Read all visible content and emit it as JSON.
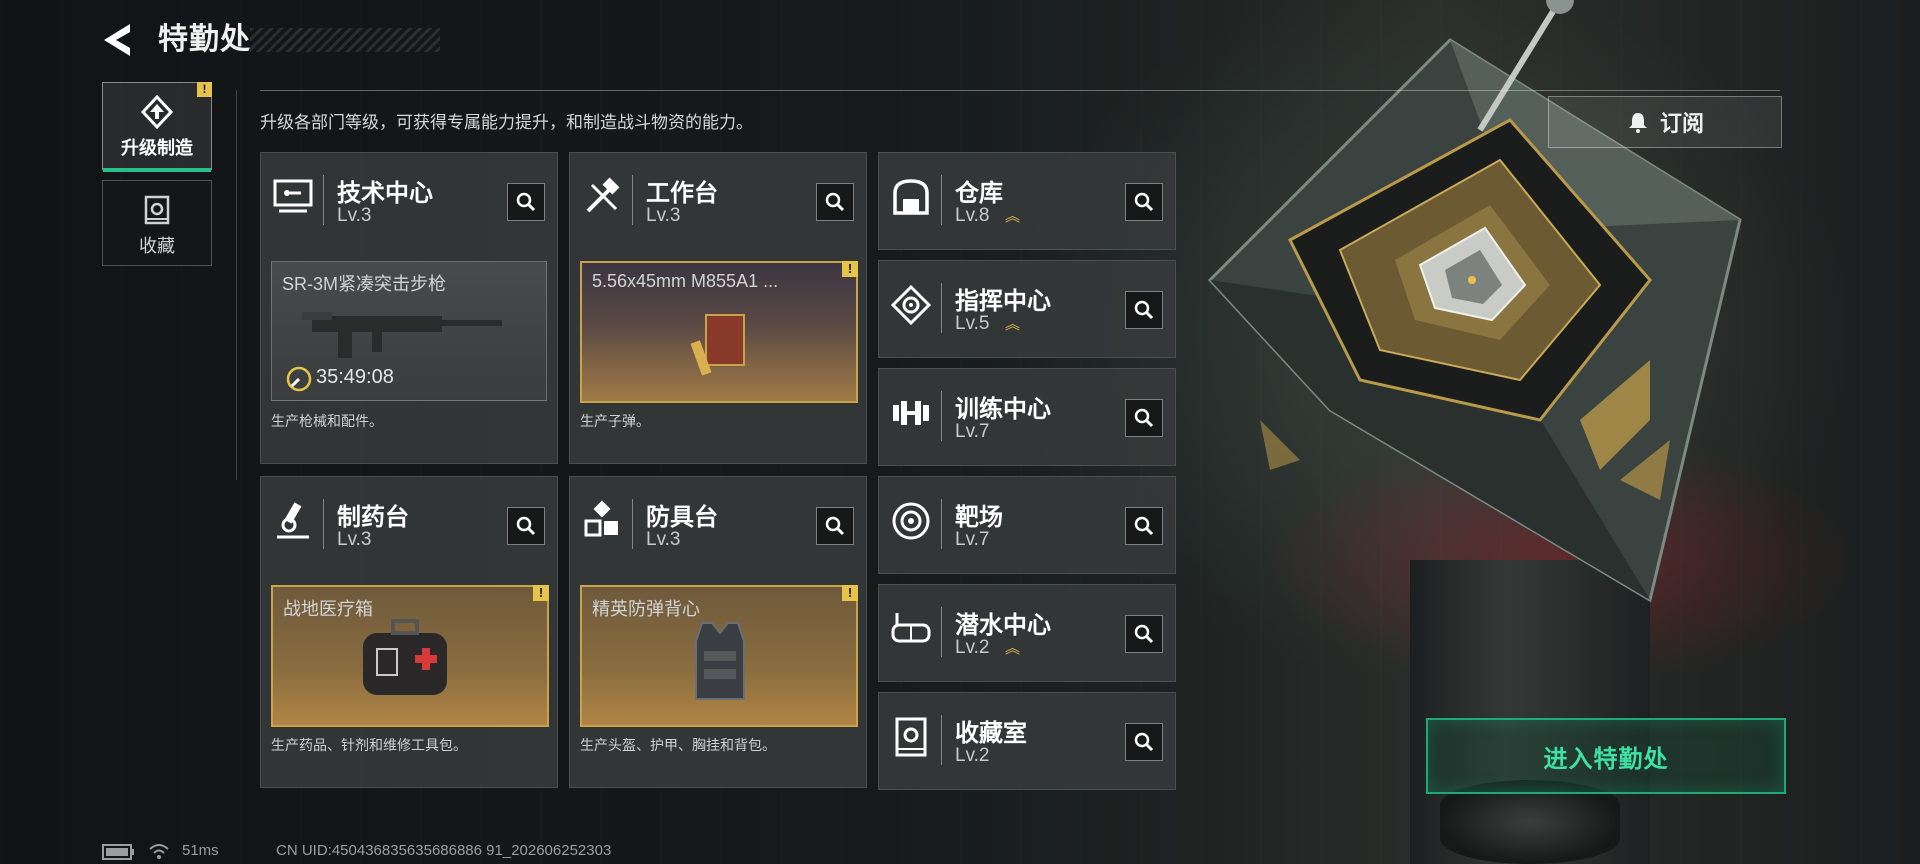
{
  "header": {
    "title": "特勤处"
  },
  "side_tabs": [
    {
      "label": "升级制造",
      "active": true,
      "badge": "!"
    },
    {
      "label": "收藏",
      "active": false
    }
  ],
  "description": "升级各部门等级，可获得专属能力提升，和制造战斗物资的能力。",
  "subscribe": {
    "label": "订阅"
  },
  "enter": {
    "label": "进入特勤处"
  },
  "workshops": {
    "tech": {
      "name": "技术中心",
      "level": "Lv.3",
      "production": {
        "title": "SR-3M紧凑突击步枪",
        "timer": "35:49:08"
      },
      "description": "生产枪械和配件。"
    },
    "bench": {
      "name": "工作台",
      "level": "Lv.3",
      "production": {
        "title": "5.56x45mm M855A1 ...",
        "badge": "!"
      },
      "description": "生产子弹。"
    },
    "pharmacy": {
      "name": "制药台",
      "level": "Lv.3",
      "production": {
        "title": "战地医疗箱",
        "badge": "!"
      },
      "description": "生产药品、针剂和维修工具包。"
    },
    "armor": {
      "name": "防具台",
      "level": "Lv.3",
      "production": {
        "title": "精英防弹背心",
        "badge": "!"
      },
      "description": "生产头盔、护甲、胸挂和背包。"
    },
    "warehouse": {
      "name": "仓库",
      "level": "Lv.8",
      "upgrade_icon": "chevron-up-double-icon"
    },
    "command": {
      "name": "指挥中心",
      "level": "Lv.5",
      "upgrade_icon": "chevron-up-double-icon"
    },
    "training": {
      "name": "训练中心",
      "level": "Lv.7"
    },
    "range": {
      "name": "靶场",
      "level": "Lv.7"
    },
    "diving": {
      "name": "潜水中心",
      "level": "Lv.2",
      "upgrade_icon": "chevron-up-double-icon"
    },
    "collection": {
      "name": "收藏室",
      "level": "Lv.2"
    }
  },
  "status": {
    "ping": "51ms",
    "uid": "CN UID:450436835635686886 91_202606252303"
  },
  "colors": {
    "accent_green": "#22c28a",
    "warning_yellow": "#e8c34a",
    "gold_border": "#c9a24a"
  }
}
